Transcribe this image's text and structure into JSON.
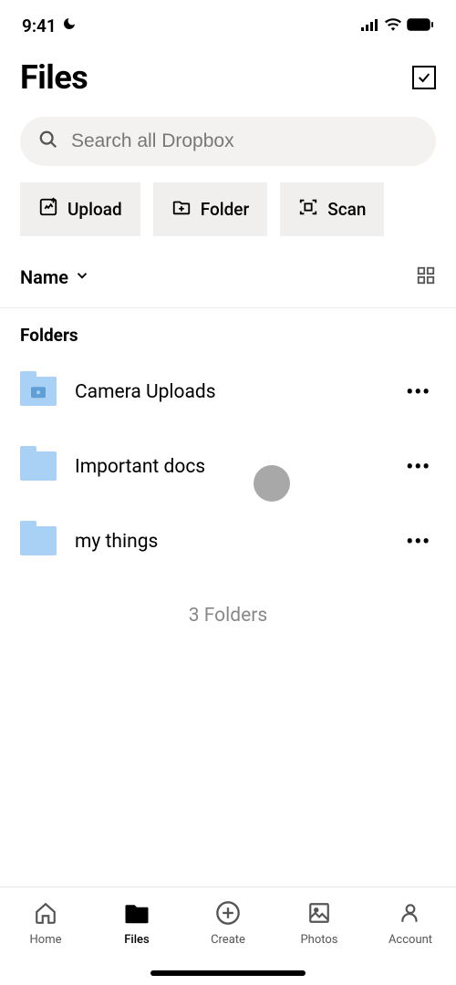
{
  "statusBar": {
    "time": "9:41"
  },
  "header": {
    "title": "Files"
  },
  "search": {
    "placeholder": "Search all Dropbox"
  },
  "actions": {
    "upload": "Upload",
    "folder": "Folder",
    "scan": "Scan"
  },
  "sort": {
    "label": "Name"
  },
  "section": {
    "title": "Folders"
  },
  "folders": [
    {
      "name": "Camera Uploads",
      "type": "camera"
    },
    {
      "name": "Important docs",
      "type": "plain"
    },
    {
      "name": "my things",
      "type": "plain"
    }
  ],
  "counter": "3 Folders",
  "tabs": {
    "home": "Home",
    "files": "Files",
    "create": "Create",
    "photos": "Photos",
    "account": "Account"
  }
}
